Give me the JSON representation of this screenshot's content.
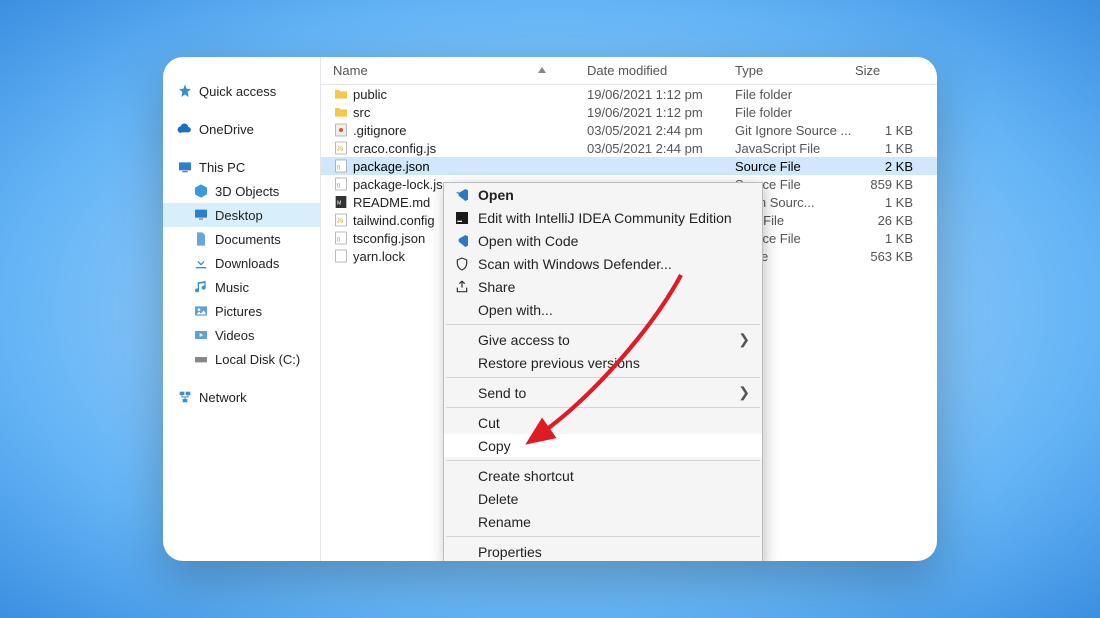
{
  "sidebar": {
    "quick_access": "Quick access",
    "onedrive": "OneDrive",
    "this_pc": "This PC",
    "children": {
      "objects3d": "3D Objects",
      "desktop": "Desktop",
      "documents": "Documents",
      "downloads": "Downloads",
      "music": "Music",
      "pictures": "Pictures",
      "videos": "Videos",
      "localdisk": "Local Disk (C:)"
    },
    "network": "Network"
  },
  "columns": {
    "name": "Name",
    "date": "Date modified",
    "type": "Type",
    "size": "Size"
  },
  "files": [
    {
      "icon": "folder",
      "name": "public",
      "date": "19/06/2021 1:12 pm",
      "type": "File folder",
      "size": ""
    },
    {
      "icon": "folder",
      "name": "src",
      "date": "19/06/2021 1:12 pm",
      "type": "File folder",
      "size": ""
    },
    {
      "icon": "git",
      "name": ".gitignore",
      "date": "03/05/2021 2:44 pm",
      "type": "Git Ignore Source ...",
      "size": "1 KB"
    },
    {
      "icon": "js",
      "name": "craco.config.js",
      "date": "03/05/2021 2:44 pm",
      "type": "JavaScript File",
      "size": "1 KB"
    },
    {
      "icon": "json",
      "name": "package.json",
      "date": "",
      "type": "Source File",
      "size": "2 KB",
      "selected": true
    },
    {
      "icon": "json",
      "name": "package-lock.js",
      "date": "",
      "type": "Source File",
      "size": "859 KB"
    },
    {
      "icon": "md",
      "name": "README.md",
      "date": "",
      "type": "down Sourc...",
      "size": "1 KB"
    },
    {
      "icon": "js",
      "name": "tailwind.config",
      "date": "",
      "type": "cript File",
      "size": "26 KB"
    },
    {
      "icon": "json",
      "name": "tsconfig.json",
      "date": "",
      "type": "Source File",
      "size": "1 KB"
    },
    {
      "icon": "file",
      "name": "yarn.lock",
      "date": "",
      "type": "K File",
      "size": "563 KB"
    }
  ],
  "context_menu": {
    "open": "Open",
    "edit_ij": "Edit with IntelliJ IDEA Community Edition",
    "open_code": "Open with Code",
    "scan_defender": "Scan with Windows Defender...",
    "share": "Share",
    "open_with": "Open with...",
    "give_access": "Give access to",
    "restore": "Restore previous versions",
    "send_to": "Send to",
    "cut": "Cut",
    "copy": "Copy",
    "create_shortcut": "Create shortcut",
    "delete": "Delete",
    "rename": "Rename",
    "properties": "Properties"
  }
}
